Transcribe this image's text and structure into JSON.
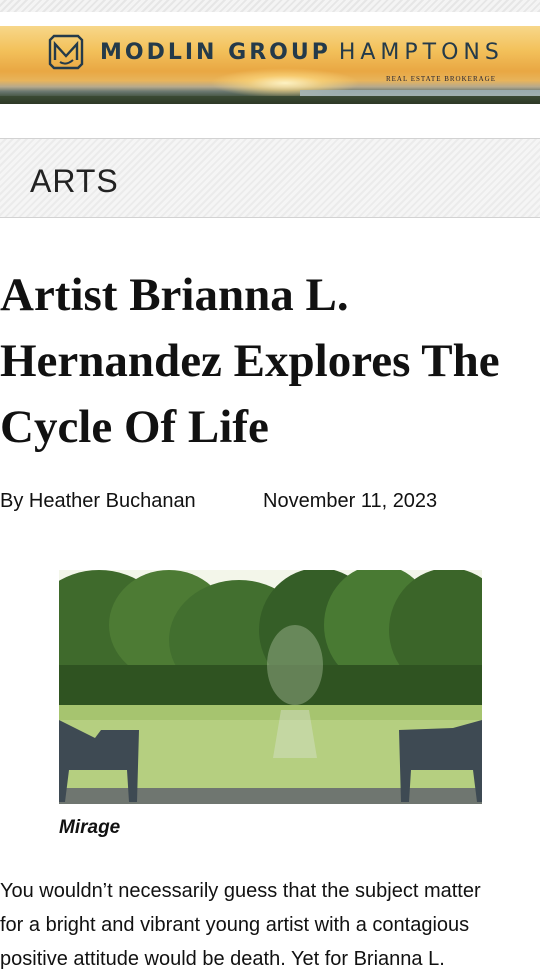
{
  "header": {
    "brand_bold": "MODLIN GROUP",
    "brand_light": "HAMPTONS",
    "tagline": "REAL ESTATE BROKERAGE"
  },
  "section": {
    "label": "ARTS"
  },
  "article": {
    "title": "Artist Brianna L. Hernandez Explores The Cycle Of Life",
    "author": "By Heather Buchanan",
    "date": "November 11, 2023",
    "image_caption": "Mirage",
    "body_line_1": "You wouldn’t necessarily guess that the subject matter",
    "body_line_2": "for a bright and vibrant young artist with a contagious",
    "body_line_3": "positive attitude would be death. Yet for Brianna L."
  },
  "icons": {
    "logo": "mg-monogram-icon"
  }
}
